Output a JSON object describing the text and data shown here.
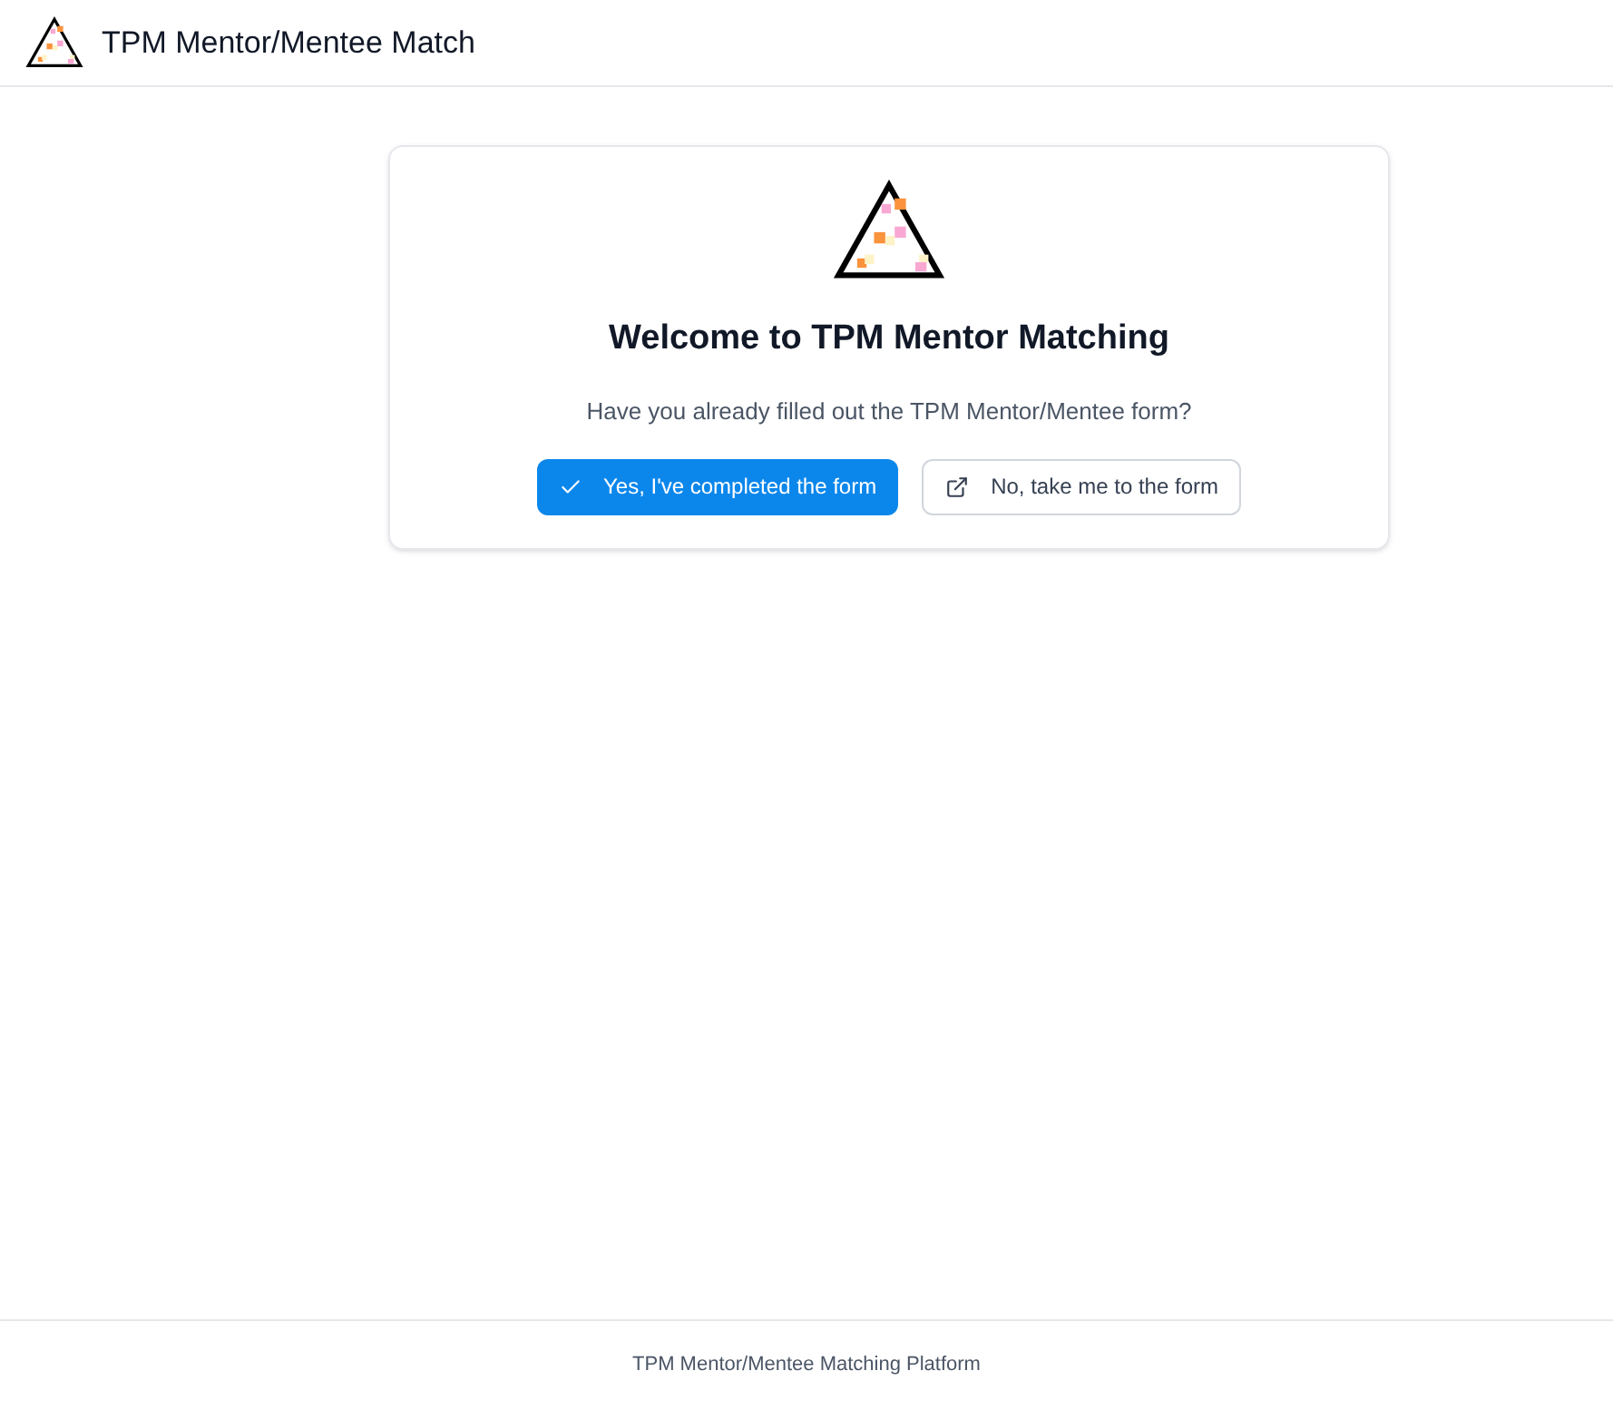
{
  "header": {
    "title": "TPM Mentor/Mentee Match"
  },
  "card": {
    "title": "Welcome to TPM Mentor Matching",
    "question": "Have you already filled out the TPM Mentor/Mentee form?",
    "buttons": [
      {
        "label": "Yes, I've completed the form",
        "kind": "primary"
      },
      {
        "label": "No, take me to the form",
        "kind": "secondary"
      }
    ]
  },
  "footer": {
    "text": "TPM Mentor/Mentee Matching Platform"
  }
}
